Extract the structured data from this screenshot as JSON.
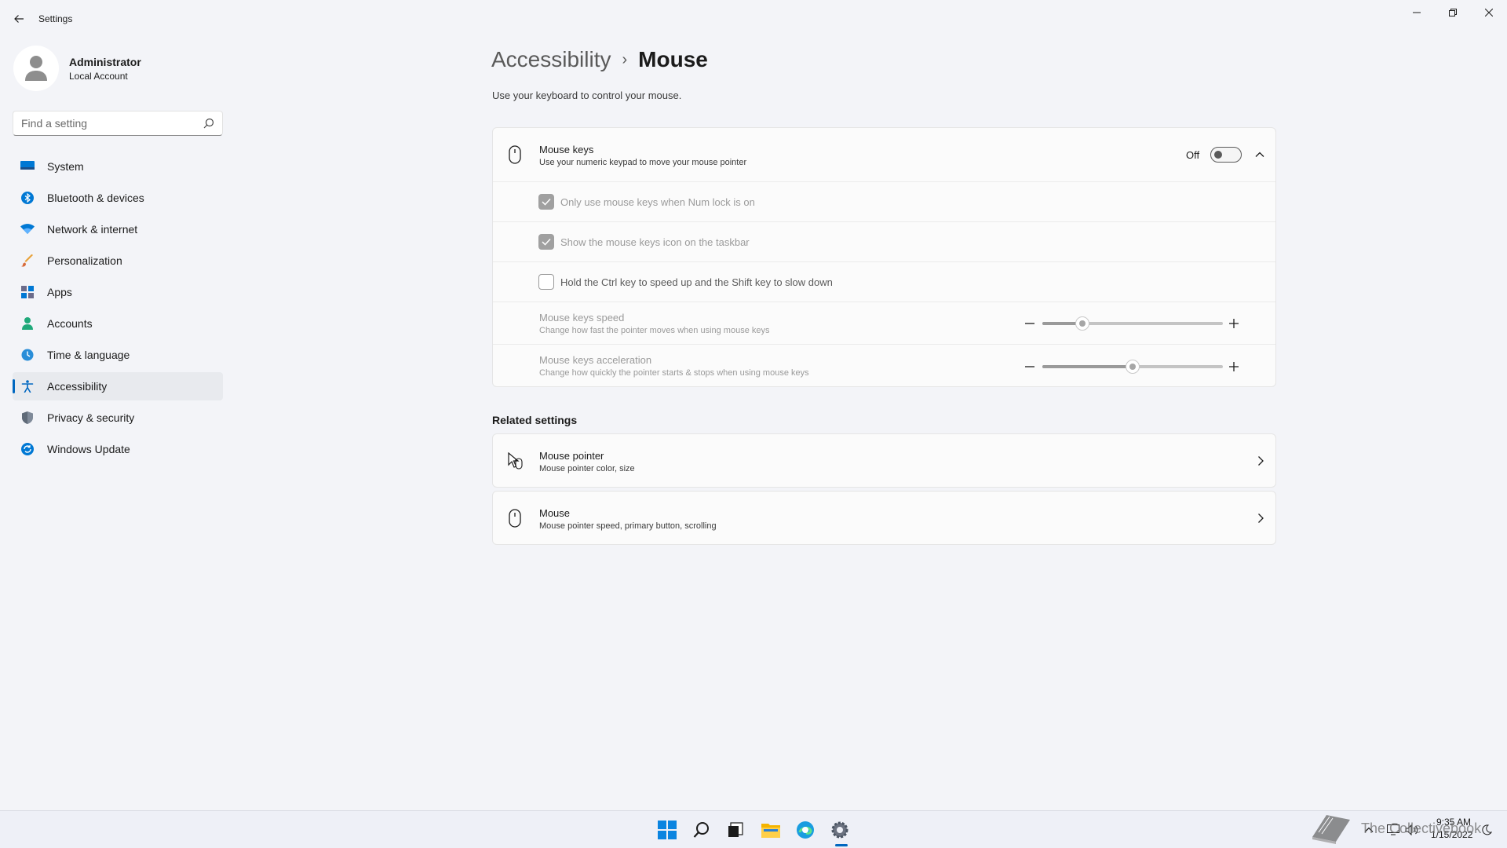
{
  "window": {
    "title": "Settings"
  },
  "profile": {
    "name": "Administrator",
    "account_type": "Local Account"
  },
  "search": {
    "placeholder": "Find a setting"
  },
  "sidebar": {
    "items": [
      {
        "label": "System",
        "icon": "monitor-icon"
      },
      {
        "label": "Bluetooth & devices",
        "icon": "bluetooth-icon"
      },
      {
        "label": "Network & internet",
        "icon": "wifi-icon"
      },
      {
        "label": "Personalization",
        "icon": "brush-icon"
      },
      {
        "label": "Apps",
        "icon": "apps-icon"
      },
      {
        "label": "Accounts",
        "icon": "person-icon"
      },
      {
        "label": "Time & language",
        "icon": "globe-clock-icon"
      },
      {
        "label": "Accessibility",
        "icon": "accessibility-icon",
        "selected": true
      },
      {
        "label": "Privacy & security",
        "icon": "shield-icon"
      },
      {
        "label": "Windows Update",
        "icon": "update-icon"
      }
    ]
  },
  "breadcrumb": {
    "parent": "Accessibility",
    "separator": "›",
    "current": "Mouse"
  },
  "page": {
    "description": "Use your keyboard to control your mouse."
  },
  "mouse_keys": {
    "title": "Mouse keys",
    "subtitle": "Use your numeric keypad to move your mouse pointer",
    "toggle_state": "Off",
    "expanded": true,
    "options": [
      {
        "label": "Only use mouse keys when Num lock is on",
        "checked": true,
        "enabled": false
      },
      {
        "label": "Show the mouse keys icon on the taskbar",
        "checked": true,
        "enabled": false
      },
      {
        "label": "Hold the Ctrl key to speed up and the Shift key to slow down",
        "checked": false,
        "enabled": false
      }
    ],
    "speed": {
      "title": "Mouse keys speed",
      "subtitle": "Change how fast the pointer moves when using mouse keys",
      "value_fraction": 0.22
    },
    "acceleration": {
      "title": "Mouse keys acceleration",
      "subtitle": "Change how quickly the pointer starts & stops when using mouse keys",
      "value_fraction": 0.5
    }
  },
  "related": {
    "heading": "Related settings",
    "items": [
      {
        "title": "Mouse pointer",
        "subtitle": "Mouse pointer color, size",
        "icon": "mouse-pointer-icon"
      },
      {
        "title": "Mouse",
        "subtitle": "Mouse pointer speed, primary button, scrolling",
        "icon": "mouse-icon"
      }
    ]
  },
  "taskbar": {
    "apps": [
      "start-icon",
      "search-icon",
      "task-view-icon",
      "file-explorer-icon",
      "edge-icon",
      "settings-icon"
    ],
    "active_app": "settings-icon",
    "clock": {
      "time": "9:35 AM",
      "date": "1/15/2022"
    }
  },
  "watermark": {
    "text": "The Collectivebook"
  },
  "colors": {
    "accent": "#0067c0",
    "background": "#f3f4f8",
    "card": "#fbfbfb"
  }
}
